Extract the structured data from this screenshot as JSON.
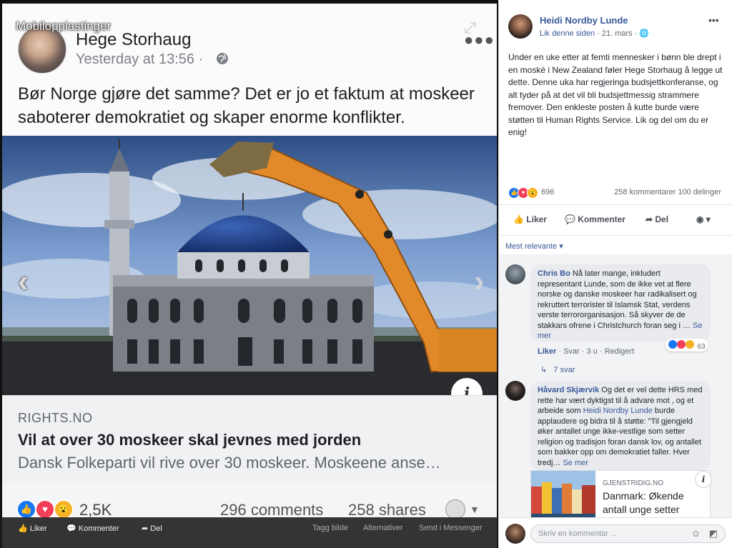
{
  "viewer": {
    "mobile_label": "Mobilopplastinger",
    "post": {
      "author": "Hege Storhaug",
      "time": "Yesterday at 13:56 ·",
      "text": "Bør Norge gjøre det samme? Det er jo et faktum at moskeer saboterer demokratiet og skaper enorme konflikter."
    },
    "link": {
      "domain": "RIGHTS.NO",
      "title": "Vil at over 30 moskeer skal jevnes med jorden",
      "description": "Dansk Folkeparti vil rive over 30 moskeer. Moskeene anse…"
    },
    "reactions": {
      "count": "2,5K",
      "comments": "296 comments",
      "shares": "258 shares"
    },
    "bar": {
      "like": "Liker",
      "comment": "Kommenter",
      "share": "Del",
      "tag": "Tagg bilde",
      "alternatives": "Alternativer",
      "send": "Send i Messenger"
    }
  },
  "sidebar": {
    "page_name": "Heidi Nordby Lunde",
    "like_page": "Lik denne siden",
    "date": "· 21. mars ·",
    "text": "Under en uke etter at femti mennesker i bønn ble drept i en moské i New Zealand føler Hege Storhaug å legge ut dette. Denne uka har regjeringa budsjettkonferanse, og alt tyder på at det vil bli budsjettmessig strammere fremover. Den enkleste posten å kutte burde være støtten til Human Rights Service. Lik og del om du er enig!",
    "reaction_count": "696",
    "stats": "258 kommentarer  100 delinger",
    "actions": {
      "like": "Liker",
      "comment": "Kommenter",
      "share": "Del"
    },
    "sort_label": "Mest relevante",
    "comments": [
      {
        "author": "Chris Bo",
        "text": "Nå later mange, inkludert representant Lunde, som de ikke vet at flere norske og danske moskeer har radikalisert og rekruttert terrorister til Islamsk Stat, verdens verste terrororganisasjon. Så skyver de de stakkars ofrene i Christchurch foran seg i …",
        "see_more": "Se mer",
        "meta_like": "Liker",
        "meta_reply": "Svar",
        "meta_time": "3 u",
        "meta_edited": "Redigert",
        "reaction_count": "63",
        "replies": "7 svar"
      },
      {
        "author": "Håvard Skjærvik",
        "text_before": "Og det er vel dette HRS med rette har vært dyktigst til å advare mot , og et arbeide som",
        "mention": "Heidi Nordby Lunde",
        "text_after": "burde applaudere og bidra til å støtte: \"Til gjengjeld øker antallet unge ikke-vestlige som setter religion og tradisjon foran dansk lov, og antallet som bakker opp om demokratiet faller. Hver tredj…",
        "see_more": "Se mer",
        "link_domain": "GJENSTRIDIG.NO",
        "link_title": "Danmark: Økende antall unge setter"
      }
    ],
    "compose_placeholder": "Skriv en kommentar ..."
  },
  "colors": {
    "fb_blue": "#385898",
    "like_blue": "#1877f2",
    "love_red": "#f33e58",
    "wow_yellow": "#f7b125"
  }
}
